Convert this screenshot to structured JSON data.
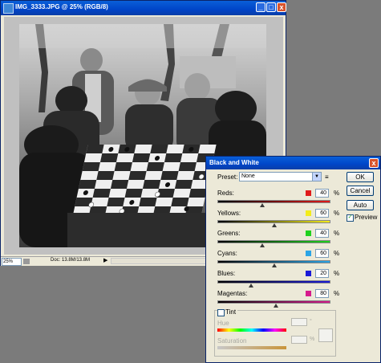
{
  "doc_window": {
    "title": "IMG_3333.JPG @ 25% (RGB/8)",
    "buttons": {
      "minimize": "_",
      "maximize": "□",
      "close": "x"
    },
    "status": {
      "zoom": "25%",
      "doc_size": "Doc: 13.8M/13.8M",
      "arrow": "▶"
    }
  },
  "dialog": {
    "title": "Black and White",
    "close_glyph": "x",
    "preset_label": "Preset:",
    "preset_value": "None",
    "preset_arrow": "▼",
    "preset_menu_icon": "≡",
    "ok_label": "OK",
    "cancel_label": "Cancel",
    "auto_label": "Auto",
    "preview_label": "Preview",
    "preview_checked": true,
    "preview_glyph": "✓",
    "channels": [
      {
        "label": "Reds:",
        "value": "40",
        "unit": "%",
        "color": "#e01a1a",
        "slider_fraction": 0.4,
        "track": "linear-gradient(90deg,#000,#e01a1a)"
      },
      {
        "label": "Yellows:",
        "value": "60",
        "unit": "%",
        "color": "#f3ec1b",
        "slider_fraction": 0.5,
        "track": "linear-gradient(90deg,#000,#f3ec1b)"
      },
      {
        "label": "Greens:",
        "value": "40",
        "unit": "%",
        "color": "#1fd11f",
        "slider_fraction": 0.4,
        "track": "linear-gradient(90deg,#000,#1fd11f)"
      },
      {
        "label": "Cyans:",
        "value": "60",
        "unit": "%",
        "color": "#2aa4e6",
        "slider_fraction": 0.5,
        "track": "linear-gradient(90deg,#000,#2aa4e6)"
      },
      {
        "label": "Blues:",
        "value": "20",
        "unit": "%",
        "color": "#1a1ad8",
        "slider_fraction": 0.3,
        "track": "linear-gradient(90deg,#000,#1a1ad8)"
      },
      {
        "label": "Magentas:",
        "value": "80",
        "unit": "%",
        "color": "#d61a8c",
        "slider_fraction": 0.52,
        "track": "linear-gradient(90deg,#000,#d61a8c)"
      }
    ],
    "tint": {
      "label": "Tint",
      "checked": false,
      "hue_label": "Hue",
      "hue_unit": "°",
      "saturation_label": "Saturation",
      "saturation_unit": "%"
    }
  }
}
